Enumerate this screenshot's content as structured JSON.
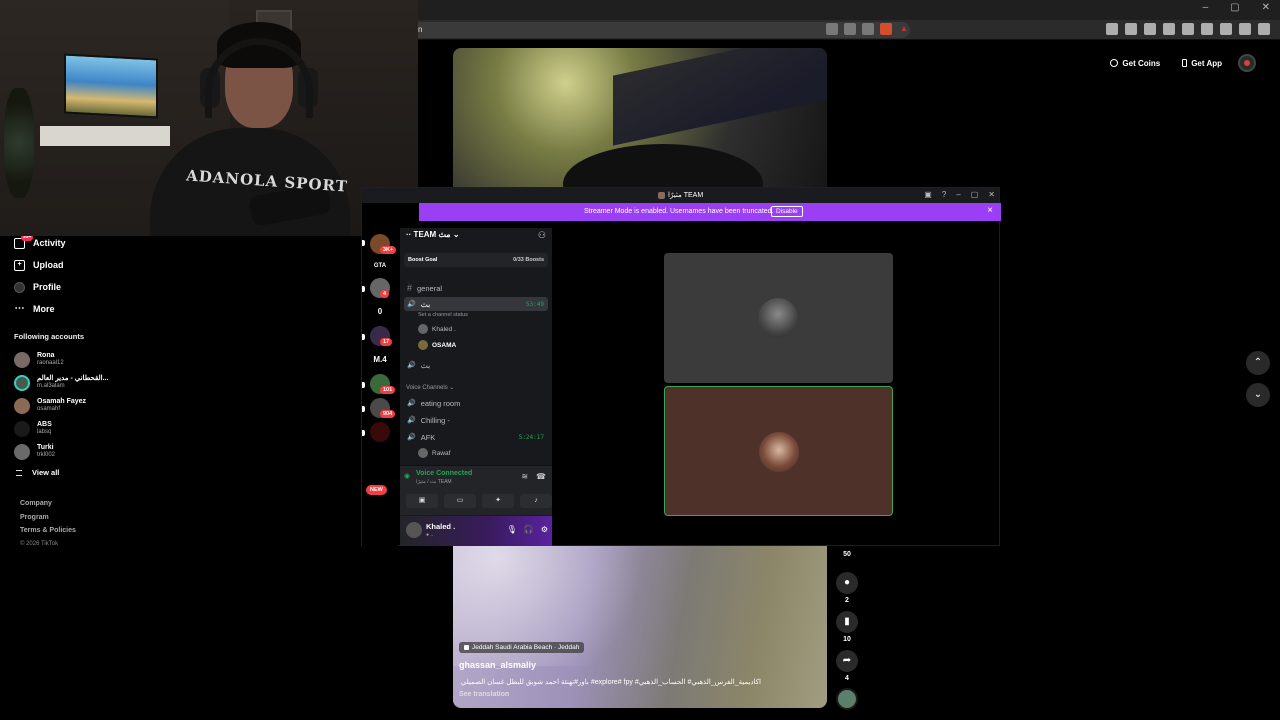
{
  "browser": {
    "window_controls": [
      "–",
      "▢",
      "✕"
    ],
    "address_text": "n"
  },
  "tiktok": {
    "get_coins": "Get Coins",
    "get_app": "Get App",
    "nav": [
      {
        "label": "Activity",
        "icon": "inbox-icon",
        "badge": "99+"
      },
      {
        "label": "Upload",
        "icon": "upload-icon"
      },
      {
        "label": "Profile",
        "icon": "profile-icon"
      },
      {
        "label": "More",
        "icon": "more-icon"
      }
    ],
    "following_title": "Following accounts",
    "following": [
      {
        "name": "Rona",
        "handle": "raonaal12"
      },
      {
        "name": "القحطاني - مدير العالم...",
        "handle": "m.al3alam"
      },
      {
        "name": "Osamah Fayez",
        "handle": "osamahf"
      },
      {
        "name": "ABS",
        "handle": "labsq"
      },
      {
        "name": "Turki",
        "handle": "trkl002"
      }
    ],
    "view_all": "View all",
    "footer": [
      "Company",
      "Program",
      "Terms & Policies",
      "© 2026 TikTok"
    ],
    "video": {
      "location": "Jeddah Saudi Arabia Beach · Jeddah",
      "username": "ghassan_alsmaliy",
      "caption": "اكاديمية_الفرس_الذهبي# الحساب_الذهبي# explore# fpy# باور#تهنئة احمد شوبق للبطل غسان الصميلي",
      "see_translation": "See translation"
    },
    "actions": {
      "share_count": "50",
      "comment_count": "2",
      "bookmark_count": "10",
      "forward_count": "4"
    }
  },
  "discord": {
    "window_title": "مثيرًا TEAM",
    "banner_text": "Streamer Mode is enabled. Usernames have been truncated.",
    "banner_button": "Disable",
    "servers": [
      {
        "badge": "3K+"
      },
      {
        "label": "GTA"
      },
      {
        "badge": "4"
      },
      {
        "label": "0"
      },
      {
        "badge": "17"
      },
      {
        "label": "M.4"
      },
      {
        "badge": "101"
      },
      {
        "badge": "904"
      },
      {
        "label": ""
      },
      {
        "label": "NEW"
      }
    ],
    "server_name": "·· TEAM مث",
    "boost_label": "Boost Goal",
    "boost_value": "0/33 Boosts",
    "channels": {
      "general": "general",
      "voice_active": "بث",
      "voice_active_timer": "53:49",
      "set_status": "Set a channel status",
      "voice_users": [
        "Khaled .",
        "OSAMA"
      ],
      "voice_second": "بث",
      "category": "Voice Channels",
      "eating_room": "eating room",
      "chilling": "Chilling -",
      "afk": "AFK",
      "afk_timer": "5:24:17",
      "afk_user": "Rawaf"
    },
    "voice_connected": "Voice Connected",
    "voice_connected_sub": "بث / مثيرًا TEAM",
    "user_name": "Khaled .",
    "user_status": "● ..",
    "colors": {
      "accent": "#9b3ff5",
      "green": "#23a55a"
    }
  }
}
